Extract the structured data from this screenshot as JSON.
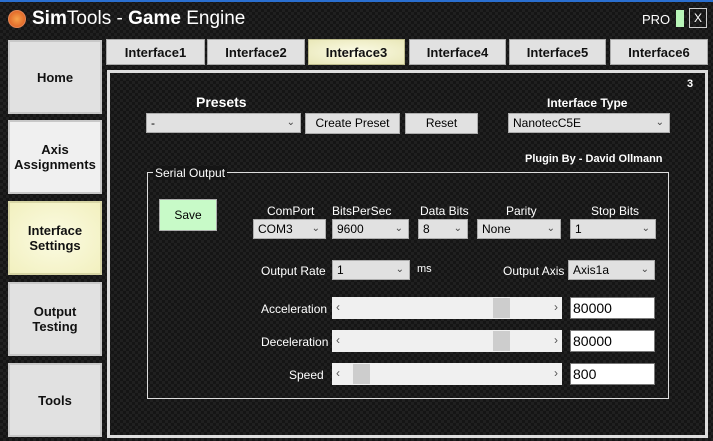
{
  "window": {
    "title_bold1": "Sim",
    "title_rest1": "Tools - ",
    "title_bold2": "Game",
    "title_rest2": " Engine",
    "pro_label": "PRO",
    "close_label": "X"
  },
  "sidebar": {
    "items": [
      {
        "label": "Home"
      },
      {
        "label": "Axis Assignments"
      },
      {
        "label": "Interface Settings",
        "active": true
      },
      {
        "label": "Output Testing"
      },
      {
        "label": "Tools"
      }
    ]
  },
  "tabs": [
    {
      "label": "Interface1"
    },
    {
      "label": "Interface2"
    },
    {
      "label": "Interface3",
      "active": true
    },
    {
      "label": "Interface4"
    },
    {
      "label": "Interface5"
    },
    {
      "label": "Interface6"
    }
  ],
  "panel": {
    "number": "3",
    "presets": {
      "label": "Presets",
      "value": "-",
      "create_label": "Create Preset",
      "reset_label": "Reset"
    },
    "interface_type": {
      "label": "Interface Type",
      "value": "NanotecC5E"
    },
    "plugin_by": "Plugin By - David Ollmann",
    "serial": {
      "title": "Serial Output",
      "save_label": "Save",
      "comport": {
        "label": "ComPort",
        "value": "COM3"
      },
      "bits": {
        "label": "BitsPerSec",
        "value": "9600"
      },
      "databits": {
        "label": "Data Bits",
        "value": "8"
      },
      "parity": {
        "label": "Parity",
        "value": "None"
      },
      "stopbits": {
        "label": "Stop Bits",
        "value": "1"
      },
      "output_rate": {
        "label": "Output Rate",
        "value": "1",
        "unit": "ms"
      },
      "output_axis": {
        "label": "Output Axis",
        "value": "Axis1a"
      },
      "acceleration": {
        "label": "Acceleration",
        "value": "80000",
        "slider_fraction": 0.8
      },
      "deceleration": {
        "label": "Deceleration",
        "value": "80000",
        "slider_fraction": 0.8
      },
      "speed": {
        "label": "Speed",
        "value": "800",
        "slider_fraction": 0.03
      }
    }
  },
  "colors": {
    "save_button": "#c8fac8",
    "active_button": "#f2f0bf",
    "title_accent": "#2a6fd0"
  }
}
